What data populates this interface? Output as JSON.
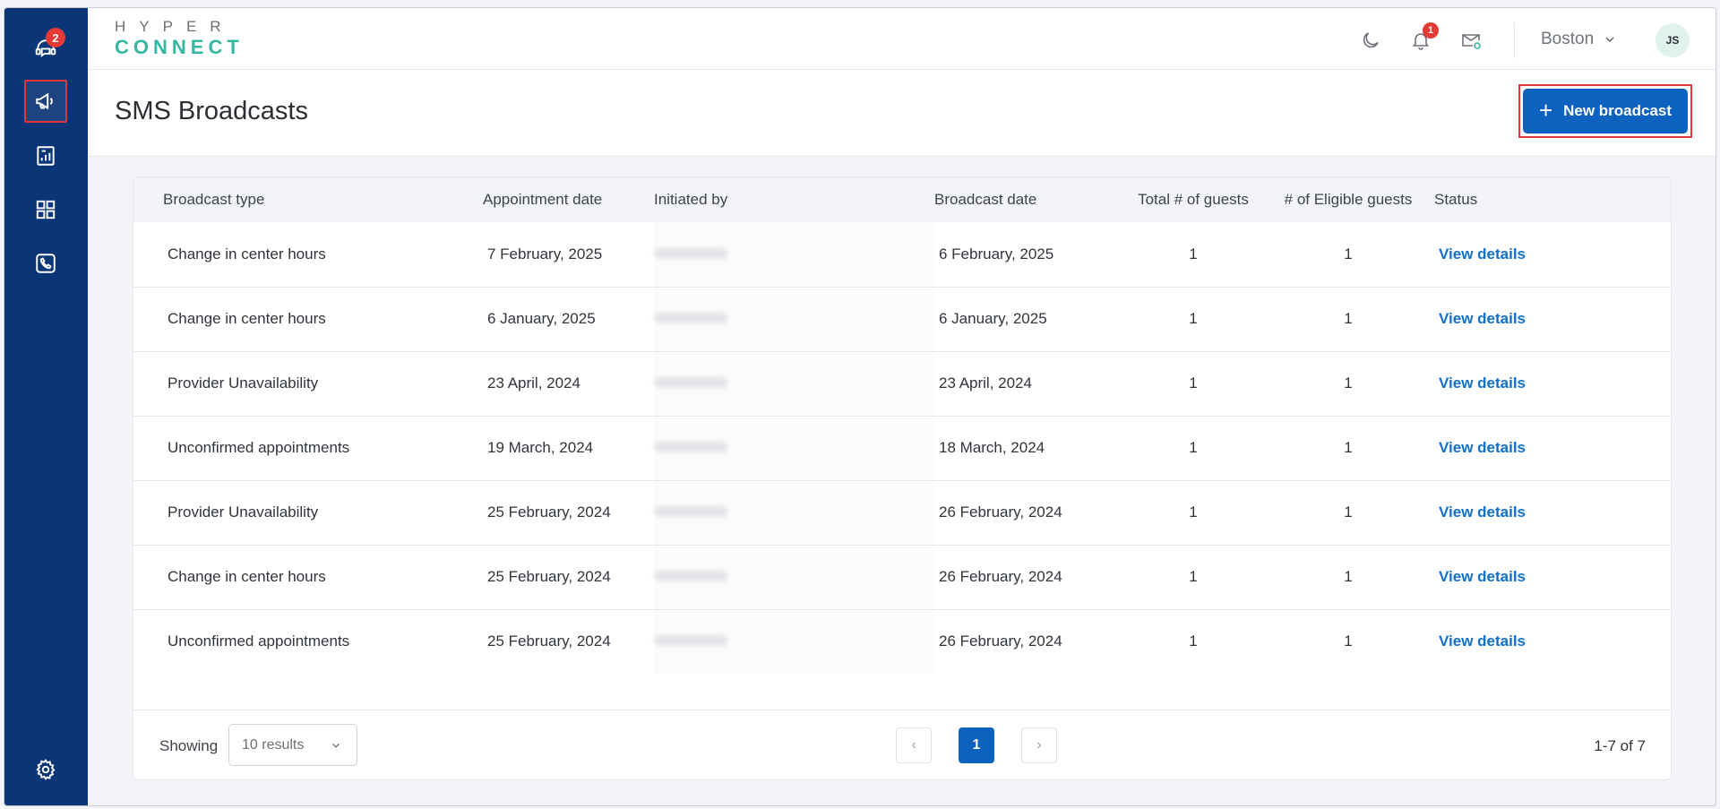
{
  "app": {
    "logo_line1": "HYPER",
    "logo_line2": "CONNECT"
  },
  "sidebar": {
    "items": [
      {
        "icon": "chat-support-icon",
        "badge": "2"
      },
      {
        "icon": "megaphone-icon",
        "active": true
      },
      {
        "icon": "report-chart-icon"
      },
      {
        "icon": "dashboard-grid-icon"
      },
      {
        "icon": "phone-icon"
      },
      {
        "icon": "settings-gear-icon"
      }
    ]
  },
  "header": {
    "notification_count": "1",
    "location": "Boston",
    "avatar_initials": "JS"
  },
  "page": {
    "title": "SMS Broadcasts",
    "new_button_label": "New broadcast"
  },
  "table": {
    "columns": [
      "Broadcast type",
      "Appointment date",
      "Initiated by",
      "Broadcast date",
      "Total # of guests",
      "# of Eligible guests",
      "Status"
    ],
    "rows": [
      {
        "type": "Change in center hours",
        "appt_date": "7 February, 2025",
        "broadcast_date": "6 February, 2025",
        "total": "1",
        "eligible": "1",
        "status": "View details"
      },
      {
        "type": "Change in center hours",
        "appt_date": "6 January, 2025",
        "broadcast_date": "6 January, 2025",
        "total": "1",
        "eligible": "1",
        "status": "View details"
      },
      {
        "type": "Provider Unavailability",
        "appt_date": "23 April, 2024",
        "broadcast_date": "23 April, 2024",
        "total": "1",
        "eligible": "1",
        "status": "View details"
      },
      {
        "type": "Unconfirmed appointments",
        "appt_date": "19 March, 2024",
        "broadcast_date": "18 March, 2024",
        "total": "1",
        "eligible": "1",
        "status": "View details"
      },
      {
        "type": "Provider Unavailability",
        "appt_date": "25 February, 2024",
        "broadcast_date": "26 February, 2024",
        "total": "1",
        "eligible": "1",
        "status": "View details"
      },
      {
        "type": "Change in center hours",
        "appt_date": "25 February, 2024",
        "broadcast_date": "26 February, 2024",
        "total": "1",
        "eligible": "1",
        "status": "View details"
      },
      {
        "type": "Unconfirmed appointments",
        "appt_date": "25 February, 2024",
        "broadcast_date": "26 February, 2024",
        "total": "1",
        "eligible": "1",
        "status": "View details"
      }
    ]
  },
  "pagination": {
    "showing_label": "Showing",
    "page_size": "10 results",
    "prev": "‹",
    "current_page": "1",
    "next": "›",
    "range": "1-7 of 7"
  },
  "colors": {
    "sidebar_bg": "#0a3577",
    "primary": "#0d62c0",
    "link": "#1170c8",
    "badge": "#e53935",
    "highlight_outline": "#e2363b"
  }
}
